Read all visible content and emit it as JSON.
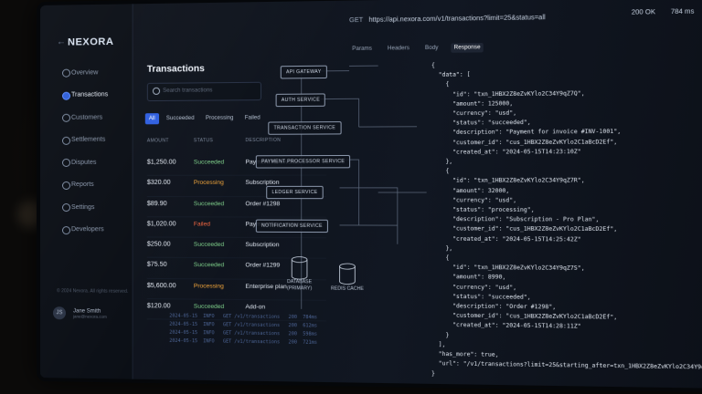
{
  "app": {
    "name": "NEXORA"
  },
  "sidebar": {
    "items": [
      {
        "label": "Overview"
      },
      {
        "label": "Transactions"
      },
      {
        "label": "Customers"
      },
      {
        "label": "Settlements"
      },
      {
        "label": "Disputes"
      },
      {
        "label": "Reports"
      },
      {
        "label": "Settings"
      },
      {
        "label": "Developers"
      }
    ],
    "copyright": "© 2024 Nexora. All rights reserved.",
    "user": {
      "initials": "JS",
      "name": "Jane Smith",
      "email": "jane@nexora.com"
    }
  },
  "transactions": {
    "title": "Transactions",
    "search_placeholder": "Search transactions",
    "filters": [
      "All",
      "Succeeded",
      "Processing",
      "Failed"
    ],
    "columns": {
      "amount": "AMOUNT",
      "status": "STATUS",
      "description": "DESCRIPTION"
    },
    "rows": [
      {
        "amount": "$1,250.00",
        "status": "Succeeded",
        "desc": "Payment for invoice"
      },
      {
        "amount": "$320.00",
        "status": "Processing",
        "desc": "Subscription"
      },
      {
        "amount": "$89.90",
        "status": "Succeeded",
        "desc": "Order #1298"
      },
      {
        "amount": "$1,020.00",
        "status": "Failed",
        "desc": "Payment for invoice"
      },
      {
        "amount": "$250.00",
        "status": "Succeeded",
        "desc": "Subscription"
      },
      {
        "amount": "$75.50",
        "status": "Succeeded",
        "desc": "Order #1299"
      },
      {
        "amount": "$5,600.00",
        "status": "Processing",
        "desc": "Enterprise plan"
      },
      {
        "amount": "$120.00",
        "status": "Succeeded",
        "desc": "Add-on"
      }
    ]
  },
  "architecture": {
    "nodes": [
      "API GATEWAY",
      "AUTH SERVICE",
      "TRANSACTION SERVICE",
      "PAYMENT PROCESSOR SERVICE",
      "LEDGER SERVICE",
      "NOTIFICATION SERVICE"
    ],
    "db_primary": [
      "DATABASE",
      "(PRIMARY)"
    ],
    "cache": "REDIS CACHE"
  },
  "request": {
    "method": "GET",
    "url": "https://api.nexora.com/v1/transactions?limit=25&status=all",
    "status": "200 OK",
    "time": "784 ms",
    "tabs": [
      "Params",
      "Headers",
      "Body",
      "Response"
    ]
  },
  "response_json": "{\n  \"data\": [\n    {\n      \"id\": \"txn_1HBX2Z8eZvKYlo2C34Y9qZ7Q\",\n      \"amount\": 125000,\n      \"currency\": \"usd\",\n      \"status\": \"succeeded\",\n      \"description\": \"Payment for invoice #INV-1001\",\n      \"customer_id\": \"cus_1HBX2Z8eZvKYlo2C1aBcD2Ef\",\n      \"created_at\": \"2024-05-15T14:23:10Z\"\n    },\n    {\n      \"id\": \"txn_1HBX2Z8eZvKYlo2C34Y9qZ7R\",\n      \"amount\": 32000,\n      \"currency\": \"usd\",\n      \"status\": \"processing\",\n      \"description\": \"Subscription - Pro Plan\",\n      \"customer_id\": \"cus_1HBX2Z8eZvKYlo2C1aBcD2Ef\",\n      \"created_at\": \"2024-05-15T14:25:42Z\"\n    },\n    {\n      \"id\": \"txn_1HBX2Z8eZvKYlo2C34Y9qZ7S\",\n      \"amount\": 8990,\n      \"currency\": \"usd\",\n      \"status\": \"succeeded\",\n      \"description\": \"Order #1298\",\n      \"customer_id\": \"cus_1HBX2Z8eZvKYlo2C1aBcD2Ef\",\n      \"created_at\": \"2024-05-15T14:28:11Z\"\n    }\n  ],\n  \"has_more\": true,\n  \"url\": \"/v1/transactions?limit=25&starting_after=txn_1HBX2Z8eZvKYlo2C34Y9qZ7S\"\n}",
  "logs": "2024-05-15  INFO   GET /v1/transactions   200  784ms\n2024-05-15  INFO   GET /v1/transactions   200  612ms\n2024-05-15  INFO   GET /v1/transactions   200  598ms\n2024-05-15  INFO   GET /v1/transactions   200  721ms",
  "colors": {
    "accent": "#2f5fe0",
    "succeeded": "#7fd18b",
    "processing": "#f0a43a",
    "failed": "#f0653f"
  }
}
